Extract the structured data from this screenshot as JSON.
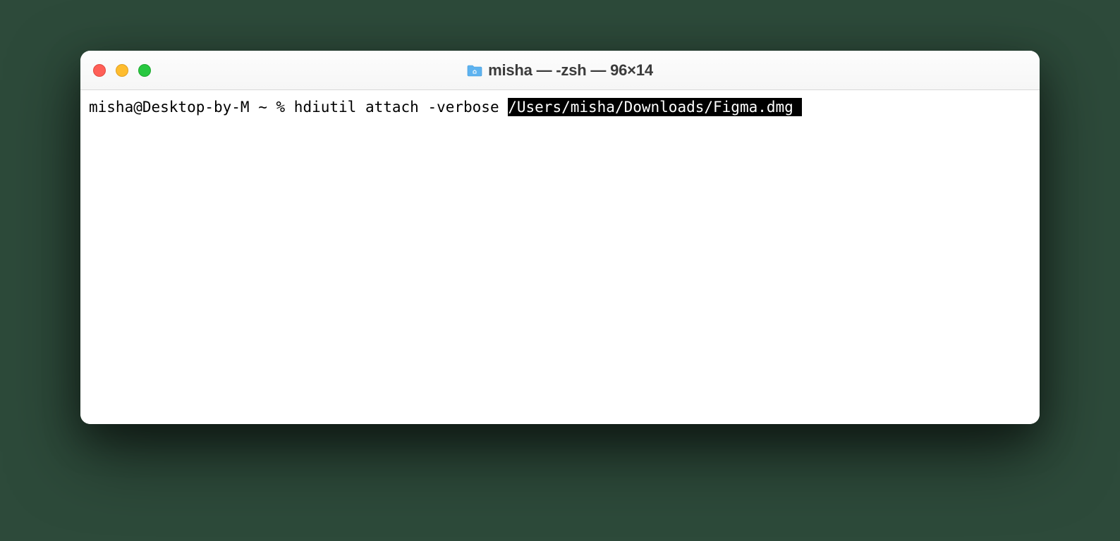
{
  "window": {
    "title": "misha — -zsh — 96×14"
  },
  "terminal": {
    "prompt": "misha@Desktop-by-M ~ % ",
    "command_plain": "hdiutil attach -verbose ",
    "command_selected": "/Users/misha/Downloads/Figma.dmg "
  }
}
